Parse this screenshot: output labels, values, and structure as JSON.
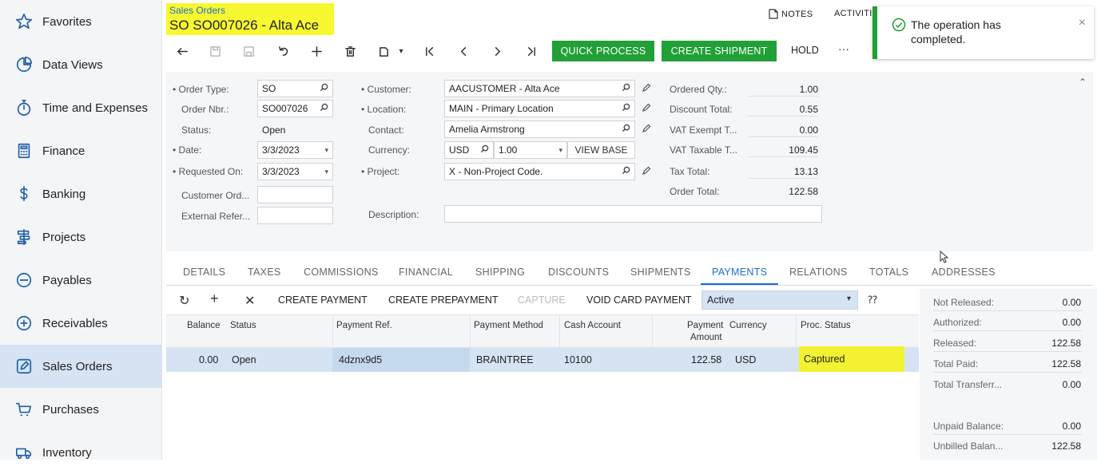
{
  "sidebar": {
    "items": [
      {
        "label": "Favorites",
        "icon": "star-icon"
      },
      {
        "label": "Data Views",
        "icon": "pie-chart-icon"
      },
      {
        "label": "Time and Expenses",
        "icon": "stopwatch-icon"
      },
      {
        "label": "Finance",
        "icon": "calculator-icon"
      },
      {
        "label": "Banking",
        "icon": "dollar-icon"
      },
      {
        "label": "Projects",
        "icon": "projects-icon"
      },
      {
        "label": "Payables",
        "icon": "minus-circle-icon"
      },
      {
        "label": "Receivables",
        "icon": "plus-circle-icon"
      },
      {
        "label": "Sales Orders",
        "icon": "edit-icon",
        "active": true
      },
      {
        "label": "Purchases",
        "icon": "cart-icon"
      },
      {
        "label": "Inventory",
        "icon": "truck-icon"
      }
    ]
  },
  "header": {
    "breadcrumb": "Sales Orders",
    "title": "SO SO007026 - Alta Ace",
    "notes": "NOTES",
    "activities": "ACTIVITI"
  },
  "toolbar": {
    "quick_process": "QUICK PROCESS",
    "create_shipment": "CREATE SHIPMENT",
    "hold": "HOLD",
    "more": "···"
  },
  "toast": {
    "message": "The operation has completed.",
    "close": "×"
  },
  "form": {
    "order_type_label": "• Order Type:",
    "order_type": "SO",
    "order_nbr_label": "Order Nbr.:",
    "order_nbr": "SO007026",
    "status_label": "Status:",
    "status": "Open",
    "date_label": "• Date:",
    "date": "3/3/2023",
    "requested_label": "• Requested On:",
    "requested": "3/3/2023",
    "customer_ord_label": "Customer Ord...",
    "customer_ord": "",
    "external_ref_label": "External Refer...",
    "external_ref": "",
    "customer_label": "• Customer:",
    "customer": "AACUSTOMER - Alta Ace",
    "location_label": "• Location:",
    "location": "MAIN - Primary Location",
    "contact_label": "Contact:",
    "contact": "Amelia Armstrong",
    "currency_label": "Currency:",
    "currency": "USD",
    "currency_rate": "1.00",
    "view_base": "VIEW BASE",
    "project_label": "• Project:",
    "project": "X - Non-Project Code.",
    "description_label": "Description:",
    "description": "",
    "ordered_qty_label": "Ordered Qty.:",
    "ordered_qty": "1.00",
    "discount_total_label": "Discount Total:",
    "discount_total": "0.55",
    "vat_exempt_label": "VAT Exempt T...",
    "vat_exempt": "0.00",
    "vat_taxable_label": "VAT Taxable T...",
    "vat_taxable": "109.45",
    "tax_total_label": "Tax Total:",
    "tax_total": "13.13",
    "order_total_label": "Order Total:",
    "order_total": "122.58"
  },
  "tabs": [
    "DETAILS",
    "TAXES",
    "COMMISSIONS",
    "FINANCIAL",
    "SHIPPING",
    "DISCOUNTS",
    "SHIPMENTS",
    "PAYMENTS",
    "RELATIONS",
    "TOTALS",
    "ADDRESSES"
  ],
  "grid_toolbar": {
    "create_payment": "CREATE PAYMENT",
    "create_prepayment": "CREATE PREPAYMENT",
    "capture": "CAPTURE",
    "void_card_payment": "VOID CARD PAYMENT",
    "filter": "Active"
  },
  "table": {
    "columns": [
      "Balance",
      "Status",
      "Payment Ref.",
      "Payment Method",
      "Cash Account",
      "Payment Amount",
      "Currency",
      "Proc. Status"
    ],
    "payment_amount_line1": "Payment",
    "payment_amount_line2": "Amount",
    "rows": [
      {
        "balance": "0.00",
        "status": "Open",
        "payment_ref": "4dznx9d5",
        "payment_method": "BRAINTREE",
        "cash_account": "10100",
        "payment_amount": "122.58",
        "currency": "USD",
        "proc_status": "Captured"
      }
    ]
  },
  "totals": {
    "not_released_label": "Not Released:",
    "not_released": "0.00",
    "authorized_label": "Authorized:",
    "authorized": "0.00",
    "released_label": "Released:",
    "released": "122.58",
    "total_paid_label": "Total Paid:",
    "total_paid": "122.58",
    "total_transfer_label": "Total Transferr...",
    "total_transfer": "0.00",
    "unpaid_balance_label": "Unpaid Balance:",
    "unpaid_balance": "0.00",
    "unbilled_balance_label": "Unbilled Balan...",
    "unbilled_balance": "122.58"
  },
  "colors": {
    "accent": "#1a6fd1",
    "success": "#21a038",
    "highlight": "#f8f832",
    "selection": "#d5e3f3"
  }
}
